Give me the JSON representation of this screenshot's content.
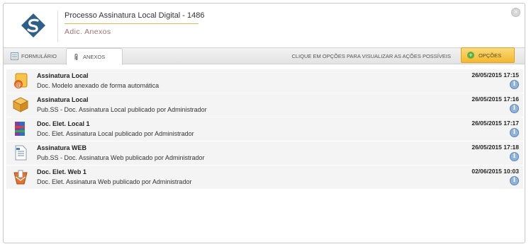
{
  "header": {
    "title": "Processo Assinatura Local Digital - 1486",
    "subtitle": "Adic. Anexos",
    "close_glyph": "×"
  },
  "tabs": [
    {
      "label": "FORMULÁRIO",
      "icon": "form-icon"
    },
    {
      "label": "ANEXOS",
      "icon": "paperclip-icon"
    }
  ],
  "hint": "CLIQUE EM OPÇÕES PARA VISUALIZAR AS AÇÕES POSSÍVEIS",
  "options_button": {
    "label": "OPÇÕES",
    "icon": "plus-icon"
  },
  "attachments": [
    {
      "title": "Assinatura Local",
      "description": "Doc. Modelo anexado de forma automática",
      "date": "26/05/2015 17:15",
      "icon": "signature-doc-icon"
    },
    {
      "title": "Assinatura Local",
      "description": "Pub.SS - Doc. Assinatura Local publicado por Administrador",
      "date": "26/05/2015 17:16",
      "icon": "package-icon"
    },
    {
      "title": "Doc. Elet. Local 1",
      "description": "Doc. Elet. Assinatura Local publicado por Administrador",
      "date": "26/05/2015 17:17",
      "icon": "winrar-icon"
    },
    {
      "title": "Assinatura WEB",
      "description": "Pub.SS - Doc. Assinatura Web publicado por Administrador",
      "date": "26/05/2015 17:18",
      "icon": "text-file-icon"
    },
    {
      "title": "Doc. Elet. Web 1",
      "description": "Doc. Elet. Assinatura Web publicado por Administrador",
      "date": "02/06/2015 10:03",
      "icon": "signed-doc-icon"
    }
  ],
  "info_glyph": "i",
  "colors": {
    "accent": "#f3b92f",
    "title_underline": "#e8b452",
    "row_bg": "#f4f4f4",
    "logo": "#2d5f8a"
  }
}
